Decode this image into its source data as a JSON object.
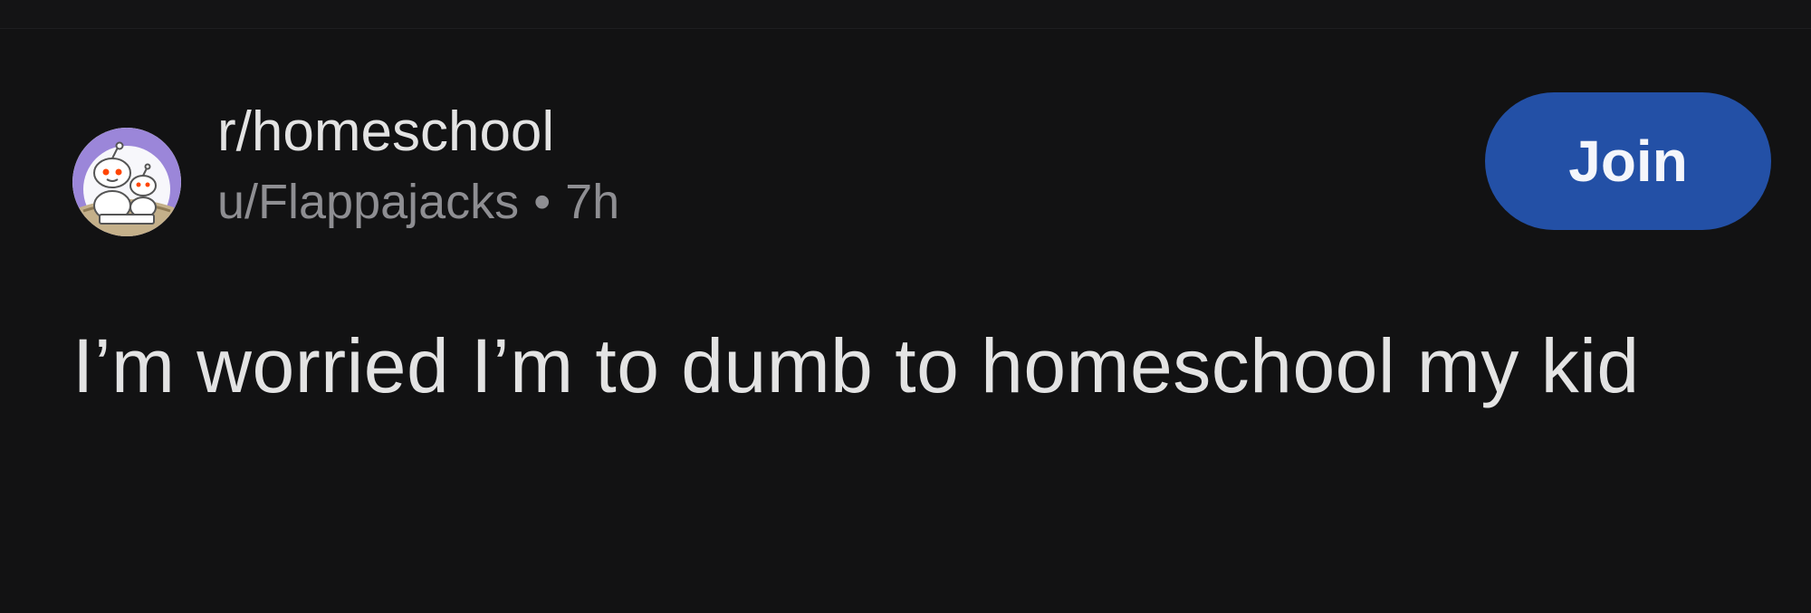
{
  "subreddit": {
    "name": "r/homeschool",
    "icon": "homeschool-snoo-icon"
  },
  "post": {
    "author": "u/Flappajacks",
    "separator": "•",
    "age": "7h",
    "title": "I’m worried I’m to dumb to homeschool my kid"
  },
  "actions": {
    "join_label": "Join"
  },
  "colors": {
    "background": "#121213",
    "join_button": "#2350a6",
    "primary_text": "#e3e3e3",
    "secondary_text": "#8e8e92",
    "avatar_ring": "#9b86d9"
  }
}
